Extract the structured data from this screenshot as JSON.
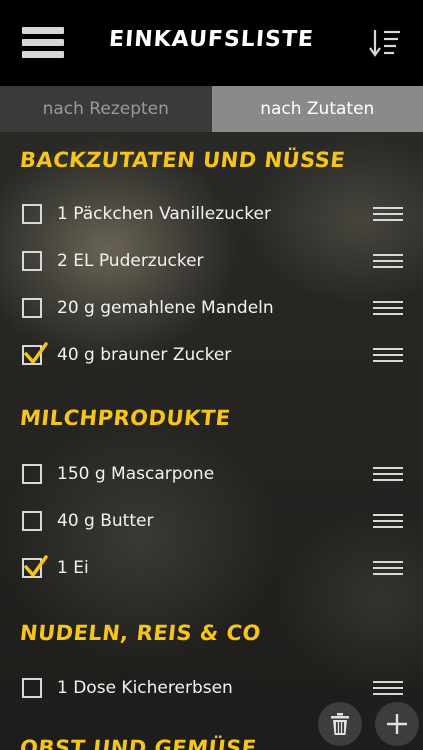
{
  "header": {
    "title": "EINKAUFSLISTE",
    "menu_icon": "hamburger-menu-icon",
    "sort_icon": "sort-list-icon"
  },
  "tabs": [
    {
      "label": "nach Rezepten",
      "active": false
    },
    {
      "label": "nach Zutaten",
      "active": true
    }
  ],
  "sections": [
    {
      "title": "BACKZUTATEN UND NÜSSE",
      "items": [
        {
          "label": "1 Päckchen Vanillezucker",
          "checked": false
        },
        {
          "label": "2 EL Puderzucker",
          "checked": false
        },
        {
          "label": "20 g gemahlene Mandeln",
          "checked": false
        },
        {
          "label": "40 g brauner Zucker",
          "checked": true
        }
      ]
    },
    {
      "title": "MILCHPRODUKTE",
      "items": [
        {
          "label": "150 g Mascarpone",
          "checked": false
        },
        {
          "label": "40 g Butter",
          "checked": false
        },
        {
          "label": "1 Ei",
          "checked": true
        }
      ]
    },
    {
      "title": "NUDELN, REIS & CO",
      "items": [
        {
          "label": "1 Dose Kichererbsen",
          "checked": false
        }
      ]
    },
    {
      "title": "OBST UND GEMÜSE",
      "items": []
    }
  ],
  "actions": {
    "delete_icon": "trash-icon",
    "add_icon": "plus-icon"
  },
  "colors": {
    "accent": "#f5c518",
    "header_bg": "#000000",
    "tab_active_bg": "#8a8a8a",
    "tab_inactive_bg": "#3a3a3a"
  }
}
